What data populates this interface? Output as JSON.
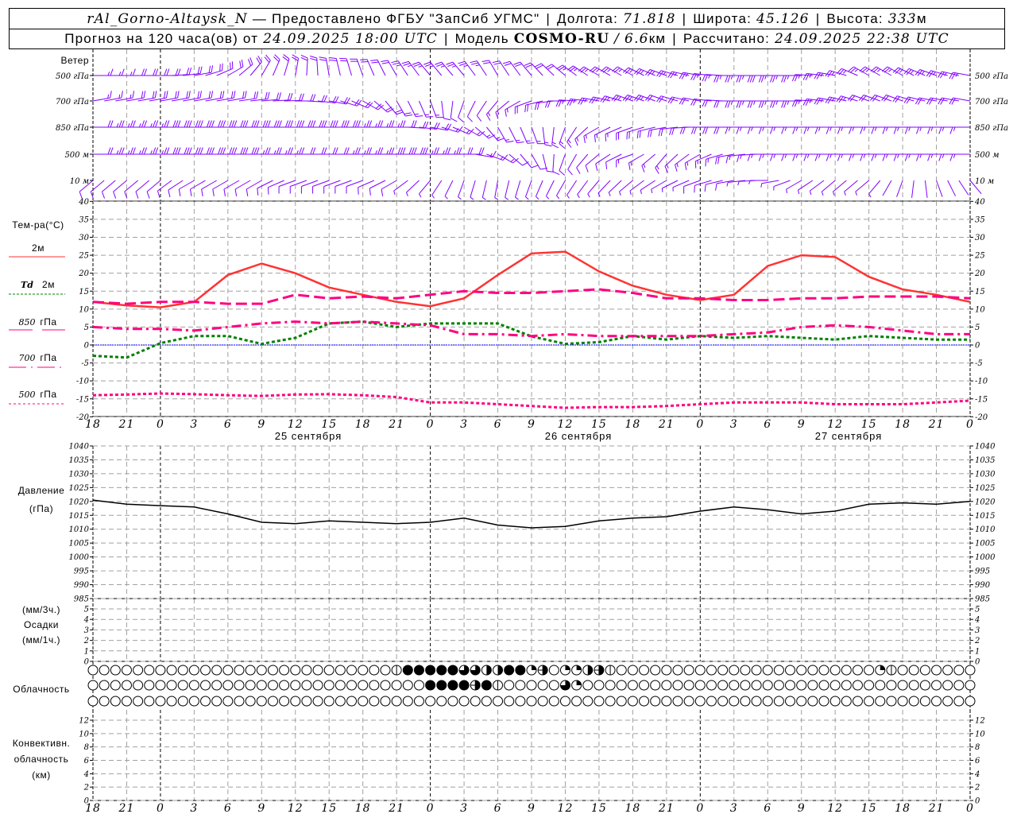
{
  "header": {
    "station": "rAl_Gorno-Altaysk_N",
    "provided": "— Предоставлено ФГБУ \"ЗапСиб УГМС\"",
    "lon_label": "Долгота:",
    "lon": "71.818",
    "lat_label": "Широта:",
    "lat": "45.126",
    "alt_label": "Высота:",
    "alt": "333",
    "alt_unit": "м",
    "forecast_label": "Прогноз на 120 часа(ов) от",
    "forecast_time": "24.09.2025 18:00 UTC",
    "model_label": "Модель",
    "model": "COSMO-RU",
    "model_sep": "/",
    "resolution": "6.6",
    "resolution_unit": "км",
    "computed_label": "Рассчитано:",
    "computed_time": "24.09.2025 22:38 UTC",
    "separator": "|"
  },
  "labels": {
    "wind": "Ветер",
    "temp": "Тем-ра(°C)",
    "t2m": "2м",
    "td": "Td",
    "td2m": "2м",
    "p850": "850",
    "p700": "700",
    "p500": "500",
    "hpa": "гПа",
    "pressure": "Давление",
    "pressure_unit": "(гПа)",
    "precip_3h": "(мм/3ч.)",
    "precip": "Осадки",
    "precip_1h": "(мм/1ч.)",
    "cloud": "Облачность",
    "conv1": "Конвективн.",
    "conv2": "облачность",
    "conv3": "(км)"
  },
  "colors": {
    "wind": "#8000ff",
    "t2m": "#ff3333",
    "td2m": "#008000",
    "levels": "#ff0080",
    "zero_line": "#0000ff",
    "grid": "#a0a0a0"
  },
  "x_axis": {
    "hour_labels": [
      "18",
      "21",
      "0",
      "3",
      "6",
      "9",
      "12",
      "15",
      "18",
      "21",
      "0",
      "3",
      "6",
      "9",
      "12",
      "15",
      "18",
      "21",
      "0",
      "3",
      "6",
      "9",
      "12",
      "15",
      "18",
      "21",
      "0"
    ],
    "dates": [
      "25 сентября",
      "26 сентября",
      "27 сентября"
    ]
  },
  "chart_data": [
    {
      "type": "wind-barbs",
      "title": "Ветер",
      "time_step_hours": 3,
      "levels": [
        {
          "name": "500 гПа",
          "dir": [
            90,
            90,
            90,
            80,
            60,
            30,
            10,
            350,
            340,
            330,
            320,
            320,
            330,
            320,
            310,
            300,
            300,
            290,
            280,
            270,
            270,
            270,
            280,
            300,
            300,
            290,
            280
          ],
          "speed": [
            8,
            10,
            10,
            10,
            10,
            10,
            10,
            10,
            12,
            12,
            14,
            14,
            12,
            12,
            12,
            14,
            14,
            14,
            14,
            14,
            15,
            14,
            14,
            14,
            14,
            14,
            14
          ]
        },
        {
          "name": "700 гПа",
          "dir": [
            80,
            80,
            80,
            80,
            80,
            85,
            90,
            100,
            120,
            150,
            160,
            200,
            220,
            250,
            270,
            280,
            290,
            290,
            280,
            270,
            270,
            270,
            280,
            290,
            290,
            280,
            280
          ],
          "speed": [
            8,
            10,
            10,
            10,
            10,
            10,
            12,
            12,
            10,
            10,
            8,
            6,
            8,
            10,
            12,
            14,
            14,
            12,
            12,
            12,
            14,
            14,
            14,
            12,
            12,
            12,
            12
          ]
        },
        {
          "name": "850 гПа",
          "dir": [
            90,
            90,
            90,
            90,
            90,
            90,
            90,
            90,
            90,
            90,
            100,
            120,
            150,
            160,
            200,
            240,
            250,
            260,
            270,
            270,
            270,
            270,
            270,
            270,
            270,
            270,
            270
          ],
          "speed": [
            12,
            14,
            15,
            15,
            15,
            16,
            16,
            16,
            14,
            12,
            10,
            8,
            8,
            8,
            8,
            8,
            10,
            10,
            10,
            10,
            8,
            8,
            8,
            8,
            8,
            8,
            8
          ]
        },
        {
          "name": "500 м",
          "dir": [
            90,
            90,
            90,
            90,
            90,
            90,
            90,
            90,
            90,
            90,
            90,
            90,
            120,
            150,
            200,
            230,
            250,
            220,
            240,
            260,
            270,
            270,
            270,
            270,
            270,
            270,
            270
          ],
          "speed": [
            12,
            14,
            15,
            16,
            16,
            14,
            12,
            12,
            14,
            16,
            14,
            10,
            8,
            6,
            5,
            6,
            8,
            8,
            8,
            10,
            8,
            8,
            8,
            8,
            8,
            8,
            8
          ]
        },
        {
          "name": "10 м",
          "dir": [
            230,
            230,
            230,
            240,
            240,
            240,
            250,
            250,
            250,
            240,
            220,
            200,
            190,
            200,
            210,
            220,
            230,
            240,
            250,
            260,
            270,
            240,
            230,
            230,
            200,
            160,
            140
          ],
          "speed": [
            5,
            5,
            5,
            5,
            5,
            5,
            5,
            5,
            5,
            5,
            4,
            3,
            3,
            3,
            3,
            4,
            4,
            4,
            5,
            5,
            4,
            3,
            3,
            3,
            2,
            2,
            2
          ]
        }
      ]
    },
    {
      "type": "line",
      "ylabel": "Тем-ра(°C)",
      "ylim": [
        -20,
        40
      ],
      "yticks": [
        "40",
        "35",
        "30",
        "25",
        "20",
        "15",
        "10",
        "5",
        "0",
        "-5",
        "-10",
        "-15",
        "-20"
      ],
      "time_step_hours": 3,
      "grid": true,
      "series": [
        {
          "name": "2м",
          "style": "solid",
          "color": "#ff3333",
          "values": [
            12,
            11,
            10.5,
            12,
            19.5,
            22.7,
            20,
            16,
            14,
            12,
            10.8,
            13,
            19.5,
            25.5,
            26,
            20.5,
            16.5,
            14,
            12.5,
            14,
            22,
            25,
            24.5,
            19,
            15.5,
            14,
            12
          ]
        },
        {
          "name": "Td 2м",
          "style": "dotted",
          "color": "#008000",
          "values": [
            -3,
            -3.5,
            0.5,
            2.5,
            2.5,
            0.3,
            2,
            6,
            6.5,
            5,
            6,
            6,
            6,
            2.4,
            0.3,
            0.8,
            2.5,
            1.5,
            2.5,
            2,
            2.5,
            2,
            1.5,
            2.5,
            2,
            1.5,
            1.5
          ]
        },
        {
          "name": "850 гПа",
          "style": "dashed",
          "color": "#ff0080",
          "values": [
            12,
            11.5,
            12,
            12,
            11.5,
            11.5,
            14,
            13,
            13.5,
            13,
            14,
            15,
            14.5,
            14.5,
            15,
            15.5,
            14.5,
            13,
            13,
            12.5,
            12.5,
            13,
            13,
            13.5,
            13.5,
            13.5,
            13
          ]
        },
        {
          "name": "700 гПа",
          "style": "dash-dot",
          "color": "#ff0080",
          "values": [
            5,
            4.5,
            4.5,
            4,
            5,
            6,
            6.5,
            6,
            6.5,
            6,
            5.5,
            3,
            3,
            2.5,
            3,
            2.5,
            2.5,
            2.5,
            2.5,
            3,
            3.5,
            5,
            5.5,
            5,
            4,
            3,
            3
          ]
        },
        {
          "name": "500 гПа",
          "style": "dotted",
          "color": "#ff0080",
          "values": [
            -14,
            -13.8,
            -13.5,
            -13.7,
            -14,
            -14.2,
            -13.8,
            -13.7,
            -14,
            -14.5,
            -16,
            -16,
            -16.5,
            -17,
            -17.5,
            -17.3,
            -17.3,
            -17,
            -16.5,
            -16,
            -16,
            -16,
            -16.5,
            -16.5,
            -16.5,
            -16,
            -15.5
          ]
        }
      ]
    },
    {
      "type": "line",
      "ylabel": "Давление (гПа)",
      "ylim": [
        985,
        1040
      ],
      "yticks": [
        "1040",
        "1035",
        "1030",
        "1025",
        "1020",
        "1015",
        "1010",
        "1005",
        "1000",
        "995",
        "990",
        "985"
      ],
      "time_step_hours": 3,
      "grid": true,
      "series": [
        {
          "color": "#000000",
          "values": [
            1020.5,
            1019,
            1018.5,
            1018,
            1015.5,
            1012.5,
            1012,
            1013,
            1012.5,
            1012,
            1012.5,
            1014,
            1011.5,
            1010.5,
            1011,
            1013,
            1014,
            1014.5,
            1016.5,
            1018,
            1017,
            1015.5,
            1016.5,
            1019,
            1019.5,
            1019,
            1020
          ]
        }
      ]
    },
    {
      "type": "bar",
      "ylabel": "Осадки (мм/3ч.) (мм/1ч.)",
      "ylim": [
        0,
        5
      ],
      "yticks": [
        "5",
        "4",
        "3",
        "2",
        "1",
        "0"
      ],
      "values": []
    },
    {
      "type": "cloud-symbols",
      "ylabel": "Облачность",
      "time_step_hours": 1,
      "unit": "okta",
      "rows": [
        {
          "27": 1,
          "28": 8,
          "29": 8,
          "30": 8,
          "31": 8,
          "32": 8,
          "33": 6,
          "34": 6,
          "35": 4,
          "36": 4,
          "37": 8,
          "38": 8,
          "39": 2,
          "40": 5,
          "42": 2,
          "43": 2,
          "44": 4,
          "45": 5,
          "46": 1,
          "70": 2,
          "71": 1
        },
        {
          "30": 8,
          "31": 8,
          "32": 8,
          "33": 8,
          "34": 5,
          "35": 8,
          "36": 1,
          "42": 6,
          "43": 2
        },
        {}
      ]
    },
    {
      "type": "bar",
      "ylabel": "Конвективн. облачность (км)",
      "ylim": [
        0,
        12
      ],
      "yticks": [
        "12",
        "10",
        "8",
        "6",
        "4",
        "2",
        "0"
      ],
      "values": []
    }
  ]
}
